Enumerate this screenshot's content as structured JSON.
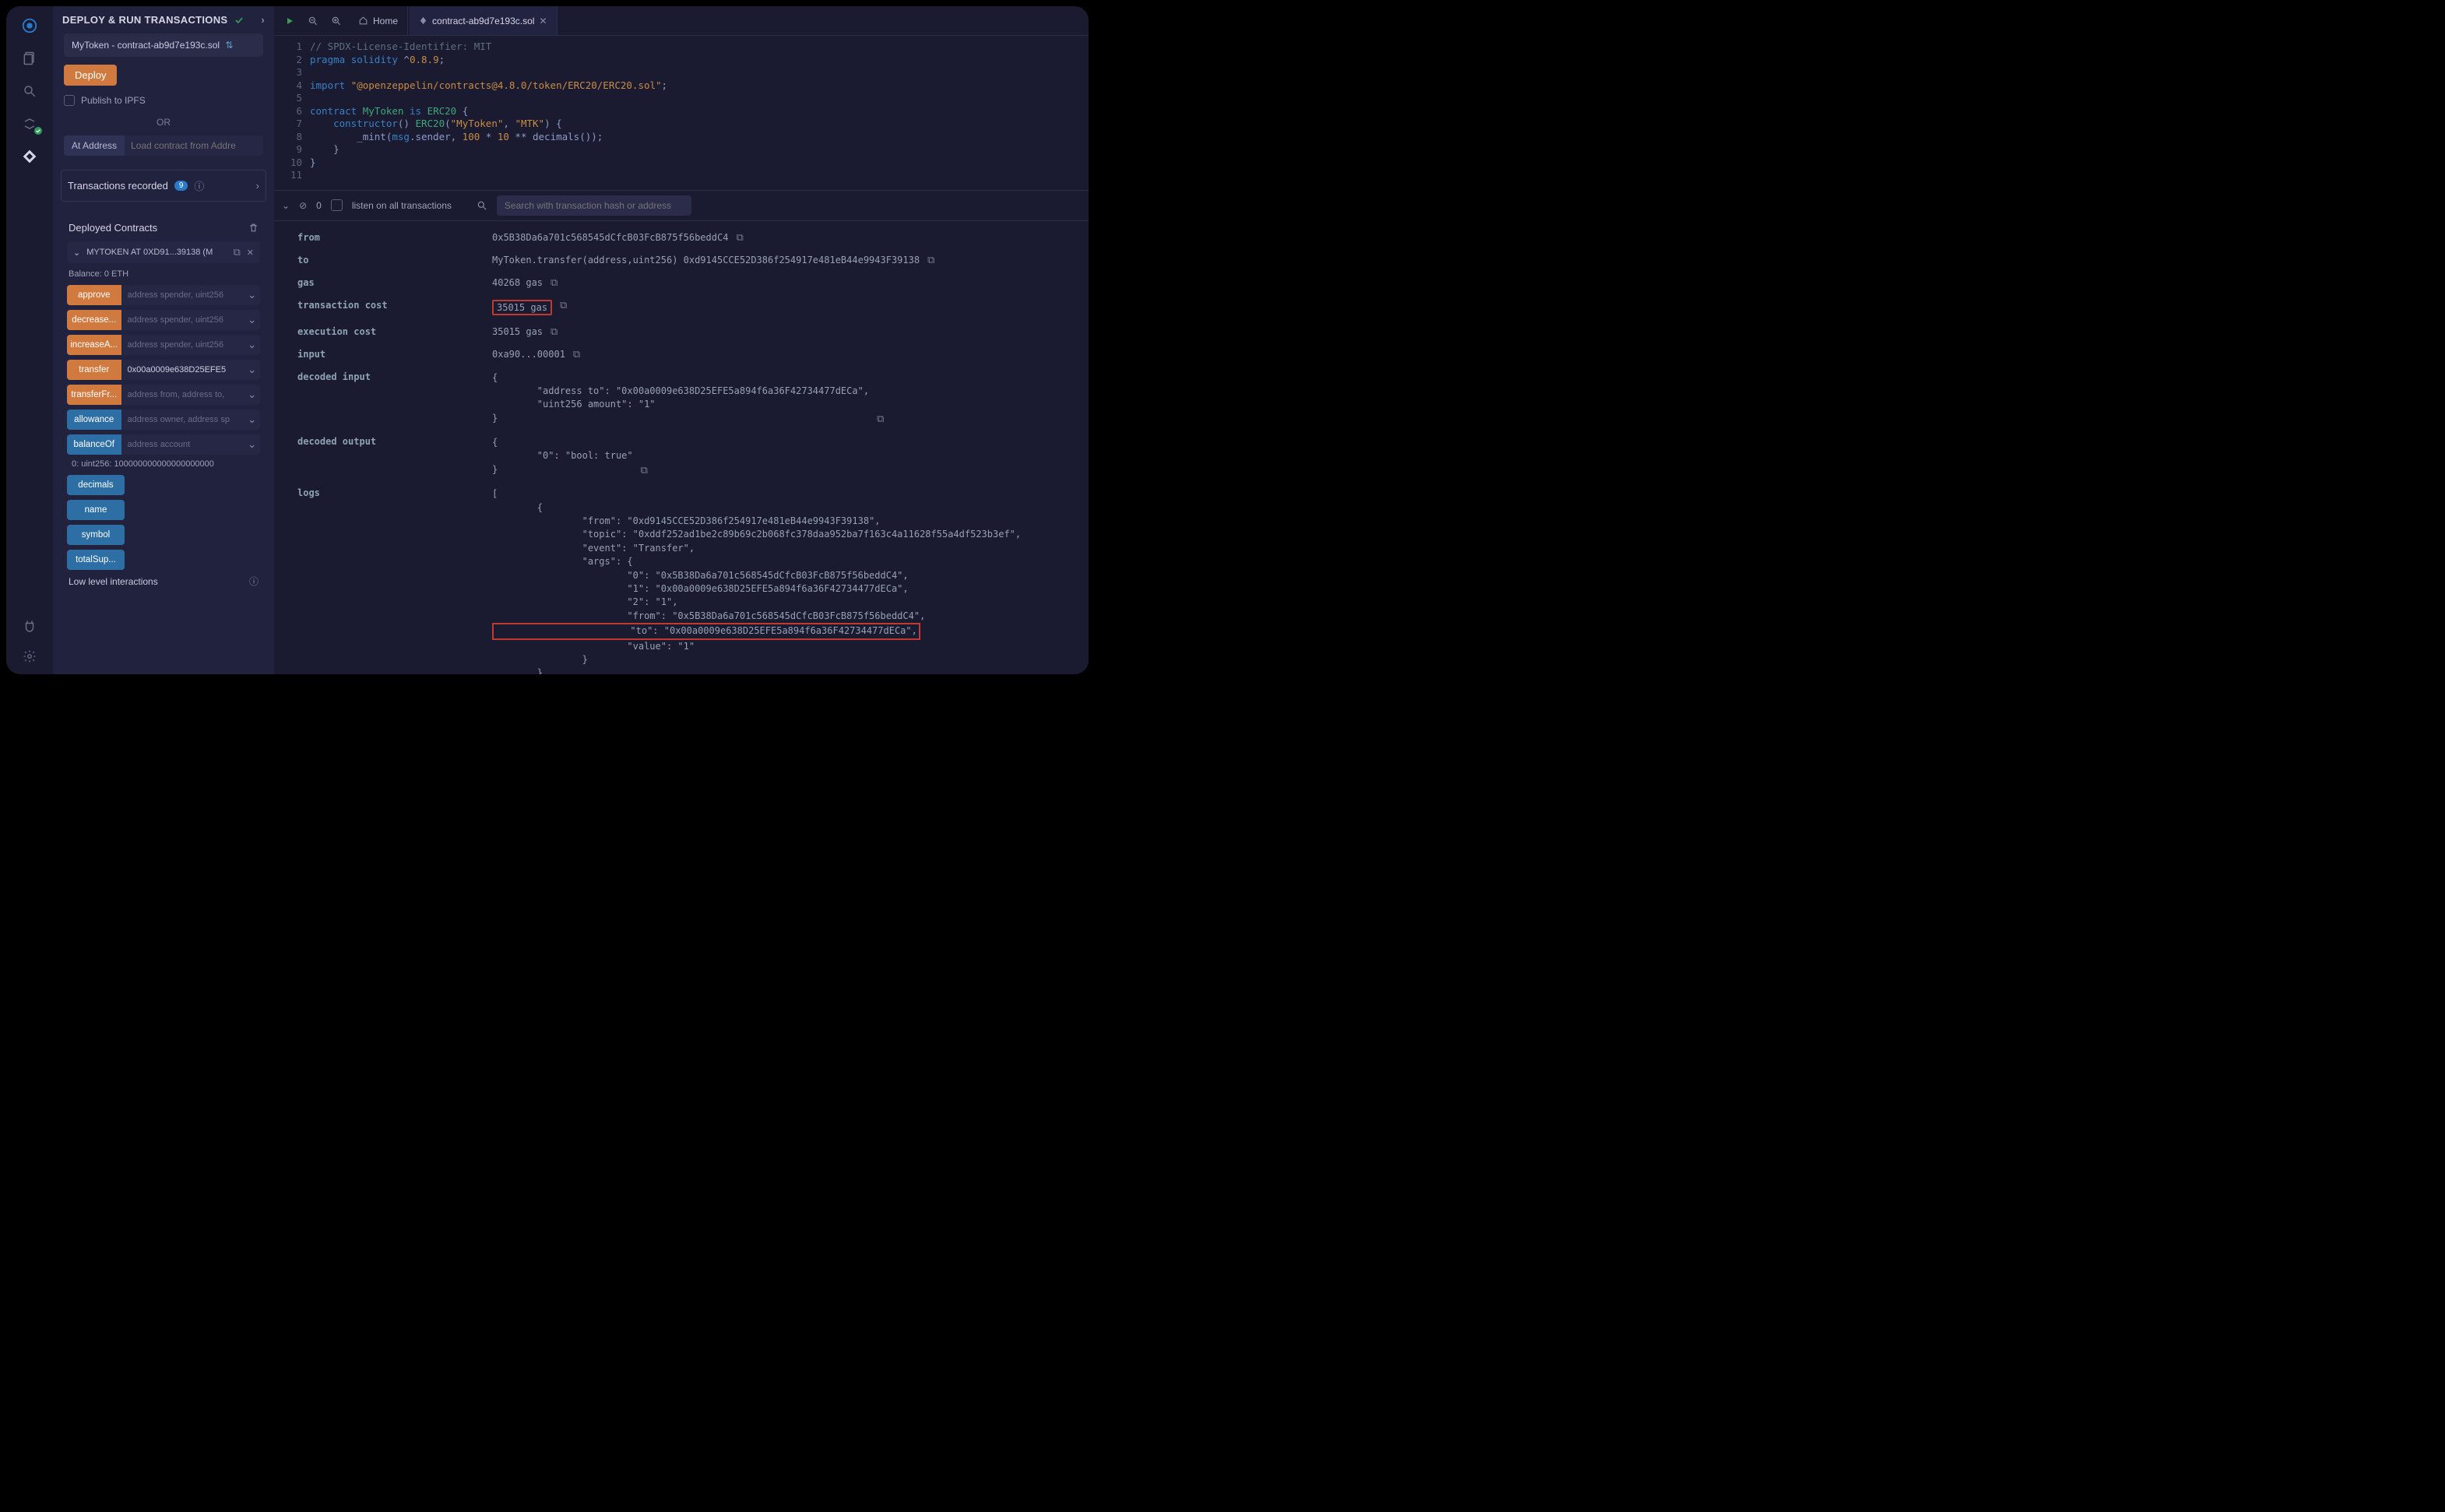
{
  "iconbar": {
    "icons": [
      "remix-logo",
      "files-icon",
      "search-icon",
      "solidity-compiler-icon",
      "deploy-run-icon",
      "plugin-icon",
      "settings-icon"
    ]
  },
  "panel": {
    "title": "DEPLOY & RUN TRANSACTIONS",
    "contract_select": "MyToken - contract-ab9d7e193c.sol",
    "deploy_label": "Deploy",
    "publish_label": "Publish to IPFS",
    "or_label": "OR",
    "at_address_label": "At Address",
    "at_address_placeholder": "Load contract from Addre",
    "tx_recorded_label": "Transactions recorded",
    "tx_recorded_count": "9",
    "deployed_label": "Deployed Contracts",
    "deployed_item": "MYTOKEN AT 0XD91...39138 (M",
    "balance": "Balance: 0 ETH",
    "funcs": [
      {
        "name": "approve",
        "kind": "orange",
        "ph": "address spender, uint256"
      },
      {
        "name": "decrease...",
        "kind": "orange",
        "ph": "address spender, uint256"
      },
      {
        "name": "increaseA...",
        "kind": "orange",
        "ph": "address spender, uint256"
      },
      {
        "name": "transfer",
        "kind": "orange",
        "val": "0x00a0009e638D25EFE5"
      },
      {
        "name": "transferFr...",
        "kind": "orange",
        "ph": "address from, address to,"
      },
      {
        "name": "allowance",
        "kind": "blue",
        "ph": "address owner, address sp"
      },
      {
        "name": "balanceOf",
        "kind": "blue",
        "ph": "address account"
      }
    ],
    "retval": "0: uint256: 100000000000000000000",
    "simple": [
      "decimals",
      "name",
      "symbol",
      "totalSup..."
    ],
    "lowlevel": "Low level interactions"
  },
  "tabs": {
    "home": "Home",
    "file": "contract-ab9d7e193c.sol"
  },
  "code": {
    "lines": [
      "// SPDX-License-Identifier: MIT",
      "pragma solidity ^0.8.9;",
      "",
      "import \"@openzeppelin/contracts@4.8.0/token/ERC20/ERC20.sol\";",
      "",
      "contract MyToken is ERC20 {",
      "    constructor() ERC20(\"MyToken\", \"MTK\") {",
      "        _mint(msg.sender, 100 * 10 ** decimals());",
      "    }",
      "}",
      ""
    ]
  },
  "terminal": {
    "zero": "0",
    "listen": "listen on all transactions",
    "search_ph": "Search with transaction hash or address"
  },
  "tx": {
    "from_label": "from",
    "from_val": "0x5B38Da6a701c568545dCfcB03FcB875f56beddC4",
    "to_label": "to",
    "to_val": "MyToken.transfer(address,uint256) 0xd9145CCE52D386f254917e481eB44e9943F39138",
    "gas_label": "gas",
    "gas_val": "40268 gas",
    "txcost_label": "transaction cost",
    "txcost_val": "35015 gas",
    "execcost_label": "execution cost",
    "execcost_val": "35015 gas",
    "input_label": "input",
    "input_val": "0xa90...00001",
    "decin_label": "decoded input",
    "decin_json": "{\n        \"address to\": \"0x00a0009e638D25EFE5a894f6a36F42734477dECa\",\n        \"uint256 amount\": \"1\"\n}",
    "decout_label": "decoded output",
    "decout_json": "{\n        \"0\": \"bool: true\"\n}",
    "logs_label": "logs",
    "logs_json_1": "[\n        {\n                \"from\": \"0xd9145CCE52D386f254917e481eB44e9943F39138\",\n                \"topic\": \"0xddf252ad1be2c89b69c2b068fc378daa952ba7f163c4a11628f55a4df523b3ef\",\n                \"event\": \"Transfer\",\n                \"args\": {\n                        \"0\": \"0x5B38Da6a701c568545dCfcB03FcB875f56beddC4\",\n                        \"1\": \"0x00a0009e638D25EFE5a894f6a36F42734477dECa\",\n                        \"2\": \"1\",\n                        \"from\": \"0x5B38Da6a701c568545dCfcB03FcB875f56beddC4\",",
    "logs_highlight": "                        \"to\": \"0x00a0009e638D25EFE5a894f6a36F42734477dECa\",",
    "logs_json_2": "                        \"value\": \"1\"\n                }\n        }\n]",
    "prompt": ">"
  }
}
